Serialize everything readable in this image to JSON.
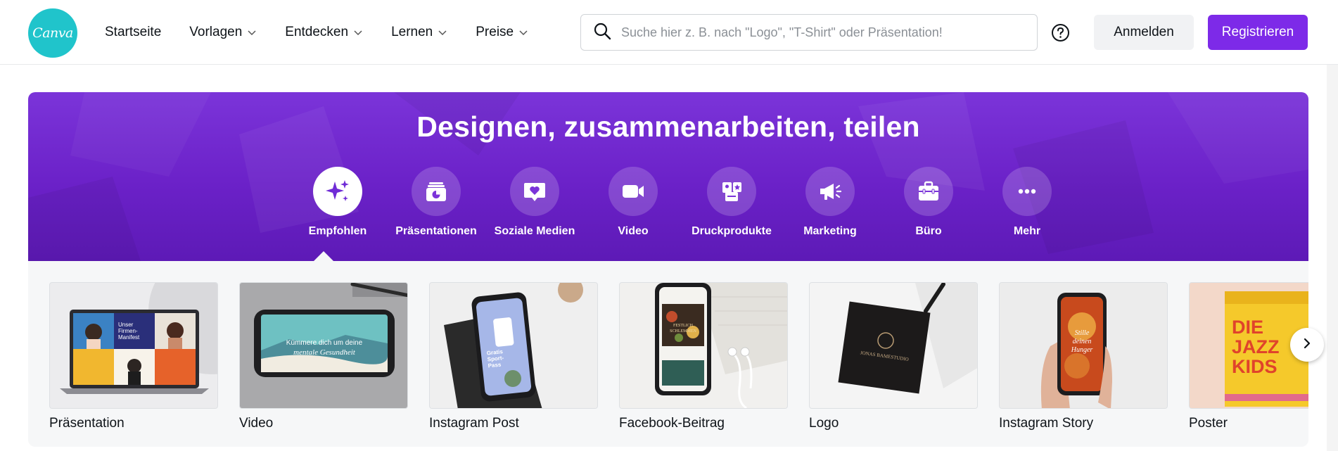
{
  "header": {
    "logo_text": "Canva",
    "nav": [
      {
        "label": "Startseite",
        "has_menu": false
      },
      {
        "label": "Vorlagen",
        "has_menu": true
      },
      {
        "label": "Entdecken",
        "has_menu": true
      },
      {
        "label": "Lernen",
        "has_menu": true
      },
      {
        "label": "Preise",
        "has_menu": true
      }
    ],
    "search_placeholder": "Suche hier z. B. nach \"Logo\", \"T-Shirt\" oder Präsentation!",
    "login_label": "Anmelden",
    "signup_label": "Registrieren"
  },
  "hero": {
    "title": "Designen, zusammenarbeiten, teilen",
    "categories": [
      {
        "label": "Empfohlen",
        "icon": "sparkle-icon",
        "active": true
      },
      {
        "label": "Präsentationen",
        "icon": "presentation-icon",
        "active": false
      },
      {
        "label": "Soziale Medien",
        "icon": "heart-chat-icon",
        "active": false
      },
      {
        "label": "Video",
        "icon": "video-camera-icon",
        "active": false
      },
      {
        "label": "Druckprodukte",
        "icon": "print-icon",
        "active": false
      },
      {
        "label": "Marketing",
        "icon": "megaphone-icon",
        "active": false
      },
      {
        "label": "Büro",
        "icon": "briefcase-icon",
        "active": false
      },
      {
        "label": "Mehr",
        "icon": "more-dots-icon",
        "active": false
      }
    ]
  },
  "templates": {
    "cards": [
      {
        "label": "Präsentation",
        "thumb_text": [
          "Unser",
          "Firmen-",
          "Manifest"
        ]
      },
      {
        "label": "Video",
        "thumb_text": [
          "Kümmere dich um deine",
          "mentale Gesundheit"
        ]
      },
      {
        "label": "Instagram Post",
        "thumb_text": [
          "Gratis",
          "Sport-",
          "Pass"
        ]
      },
      {
        "label": "Facebook-Beitrag",
        "thumb_text": [
          "FESTLICH",
          "SCHLEMMEN"
        ]
      },
      {
        "label": "Logo",
        "thumb_text": [
          "JONAS BAMESTUDIO"
        ]
      },
      {
        "label": "Instagram Story",
        "thumb_text": [
          "Stille",
          "deinen",
          "Hunger"
        ]
      },
      {
        "label": "Poster",
        "thumb_text": [
          "DIE",
          "JAZZ",
          "KIDS"
        ]
      }
    ]
  },
  "colors": {
    "brand_purple": "#7d2ae8",
    "logo_teal": "#20c4cb",
    "hero_gradient_top": "#7b34d9",
    "hero_gradient_bottom": "#5d1ab6"
  }
}
